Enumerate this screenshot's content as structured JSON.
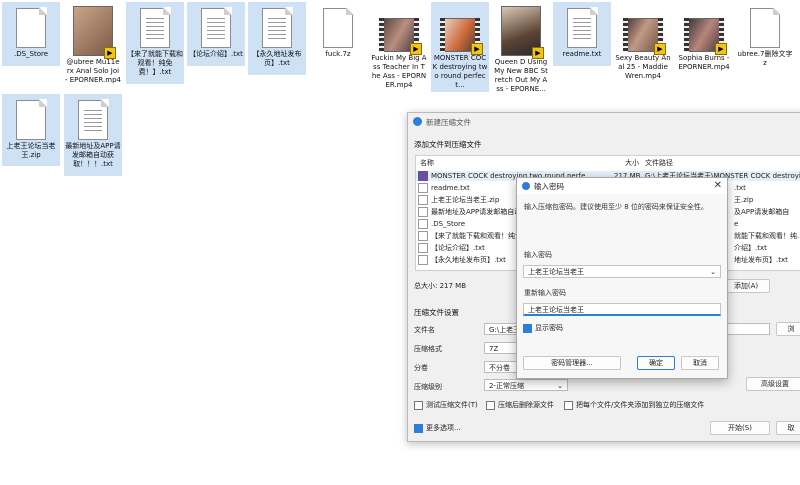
{
  "desktop": {
    "files": [
      {
        "label": ".DS_Store",
        "kind": "page"
      },
      {
        "label": "@ubree Mu11erx Anal Solo Joi - EPORNER.mp4",
        "kind": "video"
      },
      {
        "label": "【来了就能下载和观看！纯免费！】.txt",
        "kind": "page"
      },
      {
        "label": "【论坛介绍】.txt",
        "kind": "page"
      },
      {
        "label": "【永久地址发布页】.txt",
        "kind": "page"
      },
      {
        "label": "fuck.7z",
        "kind": "page"
      },
      {
        "label": "Fuckin My Big Ass Teacher In The Ass - EPORNER.mp4",
        "kind": "video"
      },
      {
        "label": "MONSTER COCK destroying two round perfect...",
        "kind": "video"
      },
      {
        "label": "Queen D Using My New BBC Stretch Out My Ass - EPORNE...",
        "kind": "video"
      },
      {
        "label": "readme.txt",
        "kind": "page"
      },
      {
        "label": "Sexy Beauty Anal 25 - Maddie Wren.mp4",
        "kind": "video"
      },
      {
        "label": "Sophia Burns - EPORNER.mp4",
        "kind": "video"
      },
      {
        "label": "ubree.7删除文字z",
        "kind": "page"
      },
      {
        "label": "上老王论坛当老王.zip",
        "kind": "page"
      },
      {
        "label": "最新地址及APP请发邮箱自动获取！！！.txt",
        "kind": "page"
      }
    ]
  },
  "archive_dialog": {
    "title": "新建压缩文件",
    "section_add": "添加文件到压缩文件",
    "col_name": "名称",
    "col_size": "大小",
    "col_path": "文件路径",
    "rows": [
      {
        "name": "MONSTER COCK destroying two round perfe...",
        "size": "217 MB",
        "path": "G:\\上老王论坛当老王\\MONSTER COCK destroyi..."
      },
      {
        "name": "readme.txt",
        "size": "",
        "path": ".txt"
      },
      {
        "name": "上老王论坛当老王.zip",
        "size": "",
        "path": "王.zip"
      },
      {
        "name": "最新地址及APP请发邮箱自动获",
        "size": "",
        "path": "及APP请发邮箱自"
      },
      {
        "name": ".DS_Store",
        "size": "",
        "path": "e"
      },
      {
        "name": "【来了就能下载和观看！纯免费",
        "size": "",
        "path": "就能下载和观看！纯..."
      },
      {
        "name": "【论坛介绍】.txt",
        "size": "",
        "path": "介绍】.txt"
      },
      {
        "name": "【永久地址发布页】.txt",
        "size": "",
        "path": "地址发布页】.txt"
      }
    ],
    "total_size": "总大小: 217 MB",
    "add_button": "添加(A)",
    "section_settings": "压缩文件设置",
    "label_filename": "文件名",
    "filename_value": "G:\\上老王",
    "browse_button": "浏",
    "label_format": "压缩格式",
    "format_value": "7Z",
    "label_split": "分卷",
    "split_value": "不分卷",
    "label_level": "压缩级别",
    "level_value": "2-正常压缩",
    "advanced_button": "高级设置",
    "check_test": "测试压缩文件(T)",
    "check_delete": "压缩后删除源文件",
    "check_separate": "把每个文件/文件夹添加到独立的压缩文件",
    "more_options": "更多选项...",
    "start_button": "开始(S)",
    "cancel_button": "取"
  },
  "password_dialog": {
    "title": "输入密码",
    "hint": "输入压缩包密码。建议使用至少 8 位的密码来保证安全性。",
    "label_password": "输入密码",
    "password_value": "上老王论坛当老王",
    "label_repeat": "重新输入密码",
    "repeat_value": "上老王论坛当老王",
    "show_password": "显示密码",
    "manager_button": "密码管理器...",
    "ok_button": "确定",
    "cancel_button": "取消"
  },
  "colors": {
    "accent": "#2e7dd7",
    "selection": "#cfe1f5",
    "dialog_bg": "#f0f0f0"
  }
}
